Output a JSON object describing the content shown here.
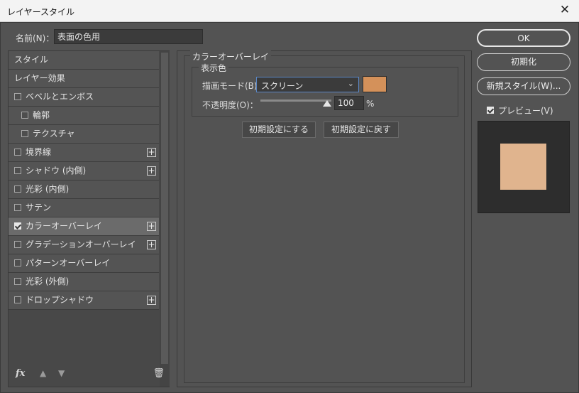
{
  "window": {
    "title": "レイヤースタイル",
    "close_icon": "close-icon"
  },
  "name_field": {
    "label": "名前(N)：",
    "value": "表面の色用"
  },
  "styles_list": {
    "items": [
      {
        "label": "スタイル",
        "checkbox": false,
        "checked": false,
        "plus": false,
        "indent": false,
        "selected": false
      },
      {
        "label": "レイヤー効果",
        "checkbox": false,
        "checked": false,
        "plus": false,
        "indent": false,
        "selected": false
      },
      {
        "label": "ベベルとエンボス",
        "checkbox": true,
        "checked": false,
        "plus": false,
        "indent": false,
        "selected": false
      },
      {
        "label": "輪郭",
        "checkbox": true,
        "checked": false,
        "plus": false,
        "indent": true,
        "selected": false
      },
      {
        "label": "テクスチャ",
        "checkbox": true,
        "checked": false,
        "plus": false,
        "indent": true,
        "selected": false
      },
      {
        "label": "境界線",
        "checkbox": true,
        "checked": false,
        "plus": true,
        "indent": false,
        "selected": false
      },
      {
        "label": "シャドウ (内側)",
        "checkbox": true,
        "checked": false,
        "plus": true,
        "indent": false,
        "selected": false
      },
      {
        "label": "光彩 (内側)",
        "checkbox": true,
        "checked": false,
        "plus": false,
        "indent": false,
        "selected": false
      },
      {
        "label": "サテン",
        "checkbox": true,
        "checked": false,
        "plus": false,
        "indent": false,
        "selected": false
      },
      {
        "label": "カラーオーバーレイ",
        "checkbox": true,
        "checked": true,
        "plus": true,
        "indent": false,
        "selected": true
      },
      {
        "label": "グラデーションオーバーレイ",
        "checkbox": true,
        "checked": false,
        "plus": true,
        "indent": false,
        "selected": false
      },
      {
        "label": "パターンオーバーレイ",
        "checkbox": true,
        "checked": false,
        "plus": false,
        "indent": false,
        "selected": false
      },
      {
        "label": "光彩 (外側)",
        "checkbox": true,
        "checked": false,
        "plus": false,
        "indent": false,
        "selected": false
      },
      {
        "label": "ドロップシャドウ",
        "checkbox": true,
        "checked": false,
        "plus": true,
        "indent": false,
        "selected": false
      }
    ],
    "footer": {
      "fx_label": "fx",
      "up_icon": "▲",
      "down_icon": "▼",
      "trash_icon": "🗑"
    }
  },
  "color_overlay": {
    "group_title": "カラーオーバーレイ",
    "subgroup_title": "表示色",
    "blend_mode_label": "描画モード(B)：",
    "blend_mode_value": "スクリーン",
    "overlay_color": "#D4915A",
    "opacity_label": "不透明度(O)：",
    "opacity_value": "100",
    "opacity_unit": "%",
    "opacity_fraction": 1.0,
    "default_set_button": "初期設定にする",
    "default_reset_button": "初期設定に戻す"
  },
  "right": {
    "ok_button": "OK",
    "reset_button": "初期化",
    "new_style_button": "新規スタイル(W)...",
    "preview_label": "プレビュー(V)",
    "preview_checked": true,
    "preview_color": "#E0B48E"
  }
}
